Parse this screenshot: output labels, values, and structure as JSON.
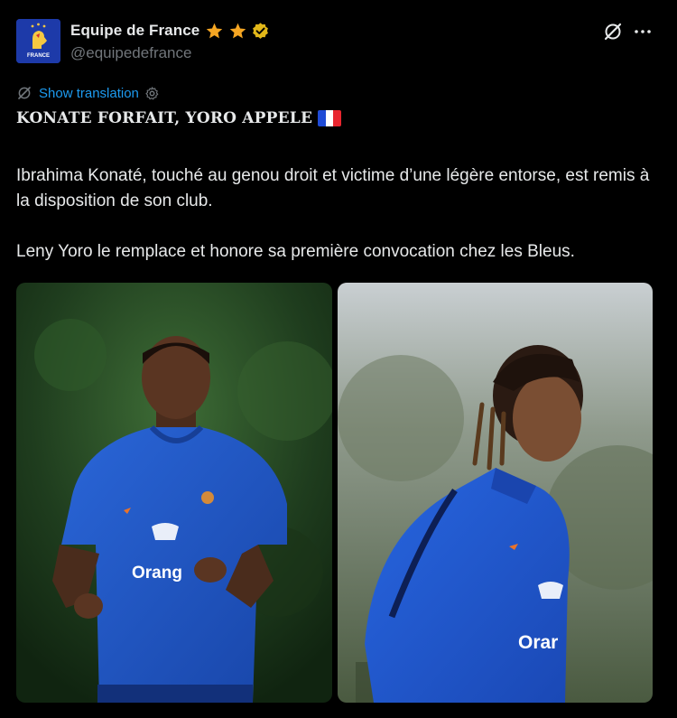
{
  "account": {
    "display_name": "Equipe de France",
    "handle": "@equipedefrance",
    "avatar_text": "FRANCE"
  },
  "translation": {
    "label": "Show translation"
  },
  "post": {
    "headline": "KONATE FORFAIT, YORO APPELE",
    "paragraph_1": "Ibrahima Konaté, touché au genou droit et victime d’une légère entorse, est remis à la disposition de son club.",
    "paragraph_2": "Leny Yoro le remplace et honore sa première convocation chez les Bleus."
  },
  "photos": {
    "left_shirt_text": "Orang",
    "right_shirt_text": "Orar"
  },
  "colors": {
    "link_blue": "#1d9bf0",
    "gold": "#f5a623",
    "france_blue": "#0a55d6",
    "muted": "#71767b"
  }
}
